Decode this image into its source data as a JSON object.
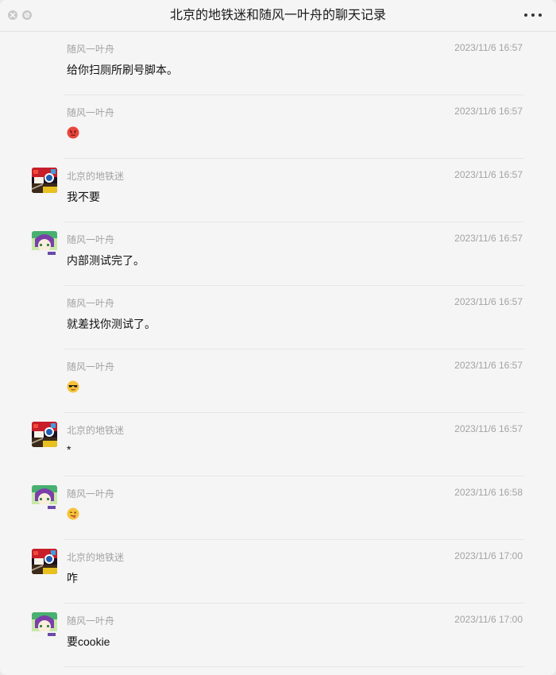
{
  "window": {
    "title": "北京的地铁迷和随风一叶舟的聊天记录"
  },
  "messages": [
    {
      "sender": "随风一叶舟",
      "time": "2023/11/6 16:57",
      "text": "给你扫厕所刷号脚本。",
      "avatar": "none",
      "emoji": ""
    },
    {
      "sender": "随风一叶舟",
      "time": "2023/11/6 16:57",
      "text": "",
      "avatar": "none",
      "emoji": "angry-face-emoji"
    },
    {
      "sender": "北京的地铁迷",
      "time": "2023/11/6 16:57",
      "text": "我不要",
      "avatar": "metro",
      "emoji": ""
    },
    {
      "sender": "随风一叶舟",
      "time": "2023/11/6 16:57",
      "text": "内部测试完了。",
      "avatar": "anime",
      "emoji": ""
    },
    {
      "sender": "随风一叶舟",
      "time": "2023/11/6 16:57",
      "text": "就差找你测试了。",
      "avatar": "none",
      "emoji": ""
    },
    {
      "sender": "随风一叶舟",
      "time": "2023/11/6 16:57",
      "text": "",
      "avatar": "none",
      "emoji": "sunglasses-face-emoji"
    },
    {
      "sender": "北京的地铁迷",
      "time": "2023/11/6 16:57",
      "text": "*",
      "avatar": "metro",
      "emoji": ""
    },
    {
      "sender": "随风一叶舟",
      "time": "2023/11/6 16:58",
      "text": "",
      "avatar": "anime",
      "emoji": "tongue-out-face-emoji"
    },
    {
      "sender": "北京的地铁迷",
      "time": "2023/11/6 17:00",
      "text": "咋",
      "avatar": "metro",
      "emoji": ""
    },
    {
      "sender": "随风一叶舟",
      "time": "2023/11/6 17:00",
      "text": "要cookie",
      "avatar": "anime",
      "emoji": ""
    }
  ]
}
